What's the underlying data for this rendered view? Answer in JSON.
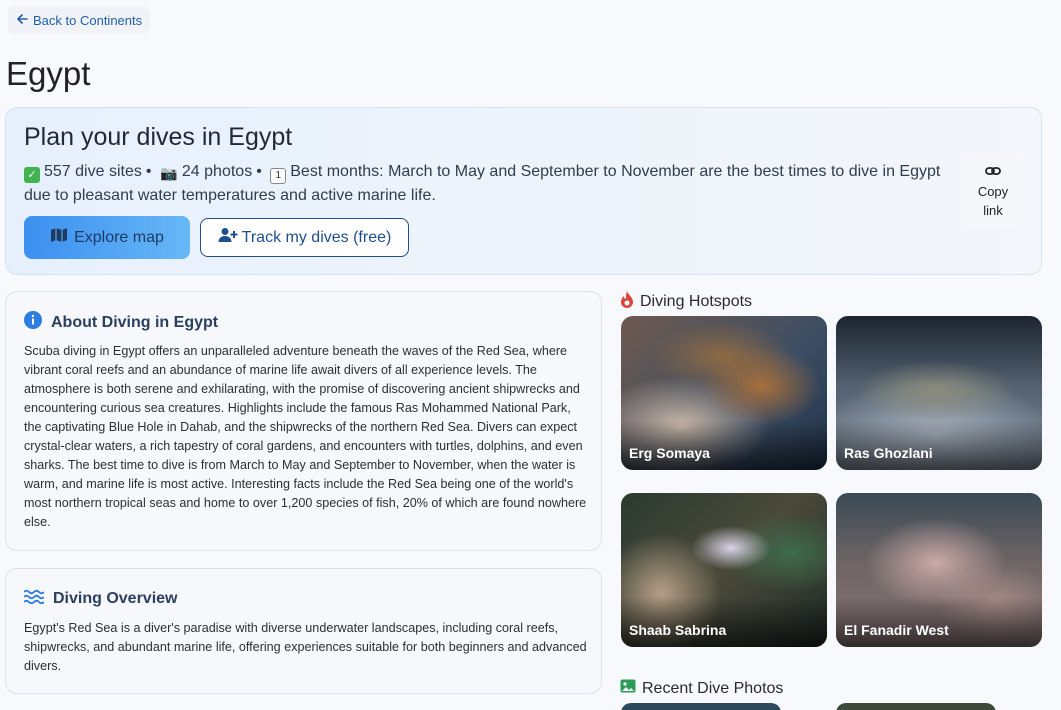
{
  "nav": {
    "back_label": "Back to Continents"
  },
  "page_title": "Egypt",
  "plan": {
    "title": "Plan your dives in Egypt",
    "dive_sites": "557 dive sites",
    "photos": "24 photos",
    "best_months": "Best months: March to May and September to November are the best times to dive in Egypt due to pleasant water temperatures and active marine life.",
    "explore_label": "Explore map",
    "track_label": "Track my dives (free)",
    "copy_label_1": "Copy",
    "copy_label_2": "link"
  },
  "about": {
    "title": "About Diving in Egypt",
    "body": "Scuba diving in Egypt offers an unparalleled adventure beneath the waves of the Red Sea, where vibrant coral reefs and an abundance of marine life await divers of all experience levels. The atmosphere is both serene and exhilarating, with the promise of discovering ancient shipwrecks and encountering curious sea creatures. Highlights include the famous Ras Mohammed National Park, the captivating Blue Hole in Dahab, and the shipwrecks of the northern Red Sea. Divers can expect crystal-clear waters, a rich tapestry of coral gardens, and encounters with turtles, dolphins, and even sharks. The best time to dive is from March to May and September to November, when the water is warm, and marine life is most active. Interesting facts include the Red Sea being one of the world's most northern tropical seas and home to over 1,200 species of fish, 20% of which are found nowhere else."
  },
  "overview": {
    "title": "Diving Overview",
    "body": "Egypt's Red Sea is a diver's paradise with diverse underwater landscapes, including coral reefs, shipwrecks, and abundant marine life, offering experiences suitable for both beginners and advanced divers."
  },
  "hotspots": {
    "title": "Diving Hotspots",
    "items": [
      {
        "name": "Erg Somaya"
      },
      {
        "name": "Ras Ghozlani"
      },
      {
        "name": "Shaab Sabrina"
      },
      {
        "name": "El Fanadir West"
      }
    ]
  },
  "recent": {
    "title": "Recent Dive Photos"
  },
  "colors": {
    "accent": "#1f5fa8",
    "hotspot_icon": "#e0443a",
    "info_icon": "#2b7de0"
  }
}
